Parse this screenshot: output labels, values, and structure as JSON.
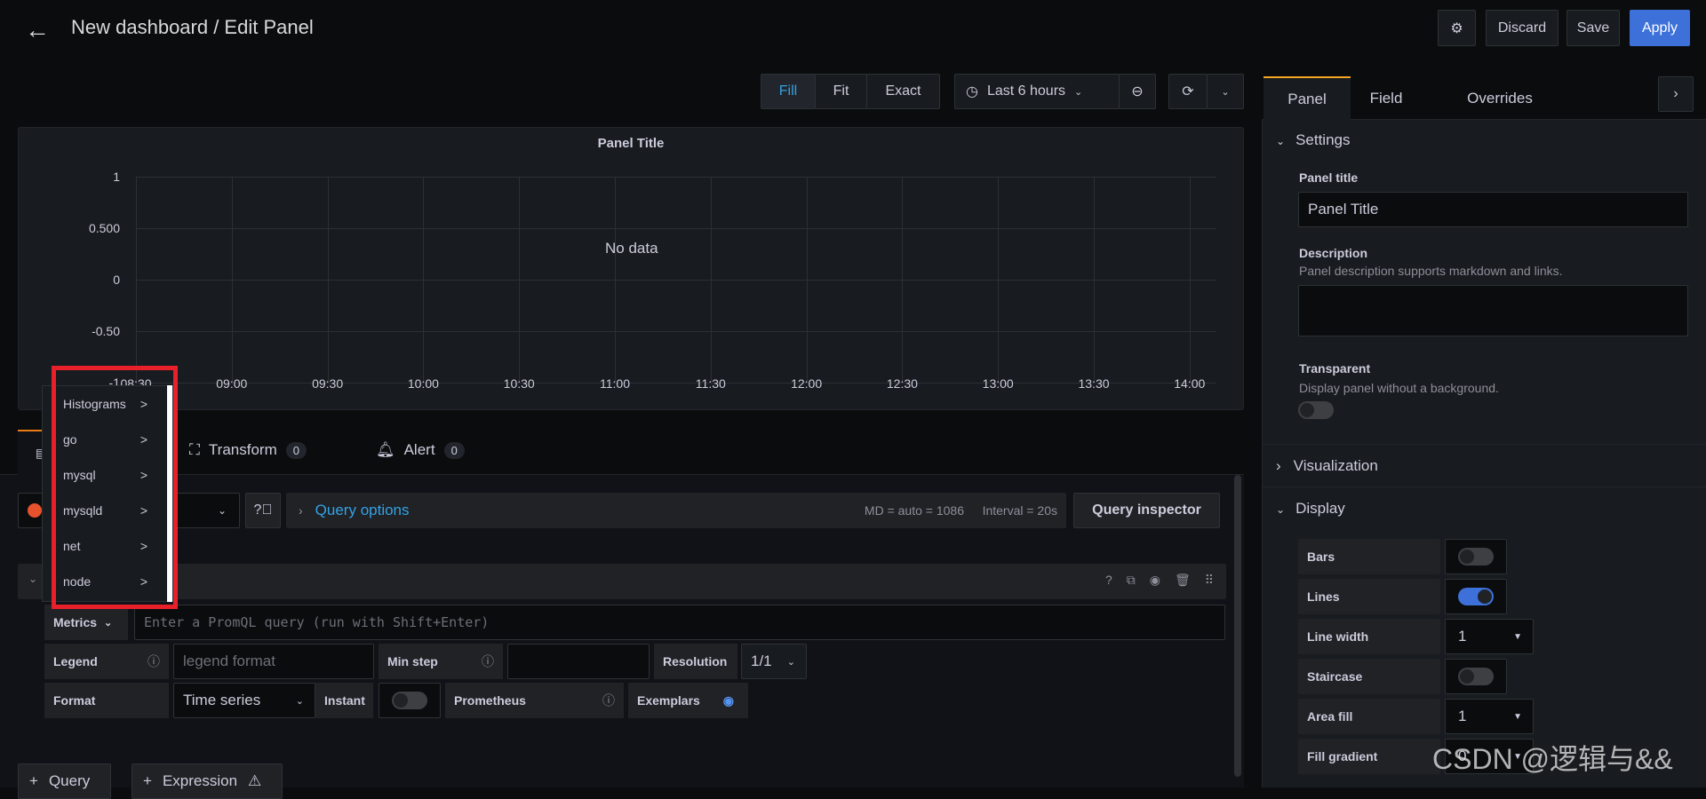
{
  "header": {
    "title": "New dashboard / Edit Panel",
    "discard": "Discard",
    "save": "Save",
    "apply": "Apply"
  },
  "toolbar": {
    "fill": "Fill",
    "fit": "Fit",
    "exact": "Exact",
    "time_range": "Last 6 hours"
  },
  "panel": {
    "title": "Panel Title",
    "no_data": "No data",
    "y_ticks": [
      "1",
      "0.500",
      "0",
      "-0.50",
      "-1"
    ],
    "x_ticks": [
      "08:30",
      "09:00",
      "09:30",
      "10:00",
      "10:30",
      "11:00",
      "11:30",
      "12:00",
      "12:30",
      "13:00",
      "13:30",
      "14:00"
    ]
  },
  "query_tabs": {
    "transform": "Transform",
    "transform_count": "0",
    "alert": "Alert",
    "alert_count": "0"
  },
  "query_options": {
    "label": "Query options",
    "md": "MD = auto = 1086",
    "interval": "Interval = 20s",
    "inspector": "Query inspector"
  },
  "metrics_menu": [
    {
      "label": "Histograms"
    },
    {
      "label": "go"
    },
    {
      "label": "mysql"
    },
    {
      "label": "mysqld"
    },
    {
      "label": "net"
    },
    {
      "label": "node"
    }
  ],
  "metrics_menu_arrow": ">",
  "query": {
    "metrics": "Metrics",
    "placeholder": "Enter a PromQL query (run with Shift+Enter)",
    "legend": "Legend",
    "legend_placeholder": "legend format",
    "min_step": "Min step",
    "resolution": "Resolution",
    "resolution_value": "1/1",
    "format": "Format",
    "format_value": "Time series",
    "instant": "Instant",
    "prometheus": "Prometheus",
    "exemplars": "Exemplars"
  },
  "bottom": {
    "query": "Query",
    "expression": "Expression"
  },
  "options": {
    "tabs": [
      "Panel",
      "Field",
      "Overrides"
    ],
    "settings": "Settings",
    "panel_title_label": "Panel title",
    "panel_title_value": "Panel Title",
    "description_label": "Description",
    "description_help": "Panel description supports markdown and links.",
    "transparent_label": "Transparent",
    "transparent_help": "Display panel without a background.",
    "visualization": "Visualization",
    "display": "Display",
    "display_rows": [
      {
        "label": "Bars",
        "type": "toggle",
        "on": false
      },
      {
        "label": "Lines",
        "type": "toggle",
        "on": true
      },
      {
        "label": "Line width",
        "type": "select",
        "value": "1"
      },
      {
        "label": "Staircase",
        "type": "toggle",
        "on": false
      },
      {
        "label": "Area fill",
        "type": "select",
        "value": "1"
      },
      {
        "label": "Fill gradient",
        "type": "select",
        "value": "0"
      }
    ]
  },
  "watermark": "CSDN @逻辑与&&",
  "colors": {
    "accent": "#3d71d9",
    "link": "#33a2e5",
    "highlight_box": "#e8202a"
  }
}
